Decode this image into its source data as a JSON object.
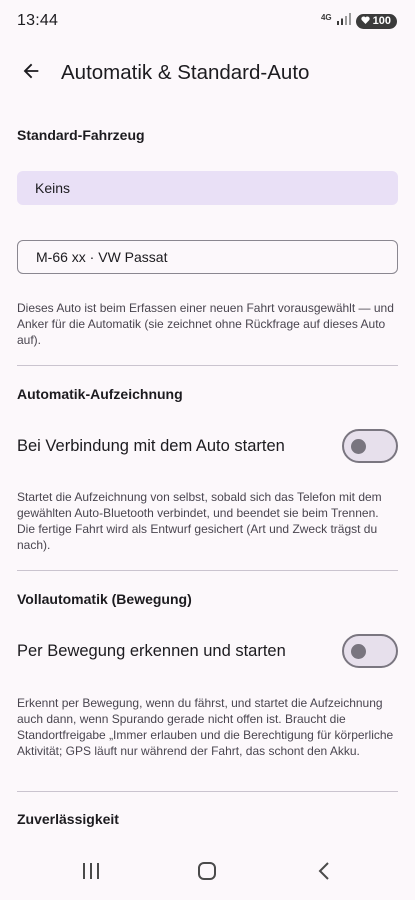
{
  "status_bar": {
    "time": "13:44",
    "network": "4G",
    "battery": "100"
  },
  "header": {
    "title": "Automatik & Standard-Auto",
    "back_icon": "arrow-back-icon"
  },
  "default_vehicle": {
    "heading": "Standard-Fahrzeug",
    "options": [
      {
        "label": "Keins",
        "selected": true
      },
      {
        "label": "M-66 xx · VW Passat",
        "selected": false
      }
    ],
    "description": "Dieses Auto ist beim Erfassen einer neuen Fahrt vorausgewählt — und Anker für die Automatik (sie zeichnet ohne Rückfrage auf dieses Auto auf)."
  },
  "auto_recording": {
    "heading": "Automatik-Aufzeichnung",
    "toggle_label": "Bei Verbindung mit dem Auto starten",
    "toggle_on": false,
    "description": "Startet die Aufzeichnung von selbst, sobald sich das Telefon mit dem gewählten Auto-Bluetooth verbindet, und beendet sie beim Trennen. Die fertige Fahrt wird als Entwurf gesichert (Art und Zweck trägst du nach)."
  },
  "full_auto": {
    "heading": "Vollautomatik (Bewegung)",
    "toggle_label": "Per Bewegung erkennen und starten",
    "toggle_on": false,
    "description": "Erkennt per Bewegung, wenn du fährst, und startet die Aufzeichnung auch dann, wenn Spurando gerade nicht offen ist. Braucht die Standortfreigabe „Immer erlauben und die Berechtigung für körperliche Aktivität; GPS läuft nur während der Fahrt, das schont den Akku."
  },
  "reliability": {
    "heading": "Zuverlässigkeit"
  },
  "nav_bar": {
    "recents_icon": "recents-icon",
    "home_icon": "home-icon",
    "back_icon": "back-chevron-icon"
  },
  "colors": {
    "background": "#fcf8fb",
    "selected_option": "#e9e0f6",
    "text_primary": "#1c1b1f",
    "text_secondary": "#49454f",
    "switch_track": "#e7e0ec",
    "switch_outline": "#7a7680"
  }
}
